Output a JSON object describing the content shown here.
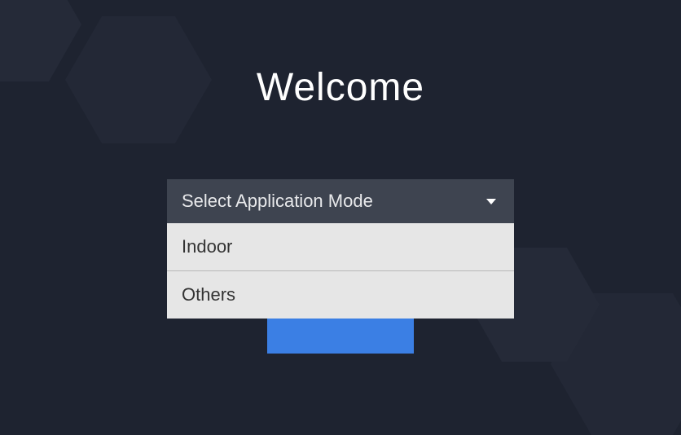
{
  "title": "Welcome",
  "dropdown": {
    "placeholder": "Select Application Mode",
    "options": [
      {
        "label": "Indoor"
      },
      {
        "label": "Others"
      }
    ]
  }
}
